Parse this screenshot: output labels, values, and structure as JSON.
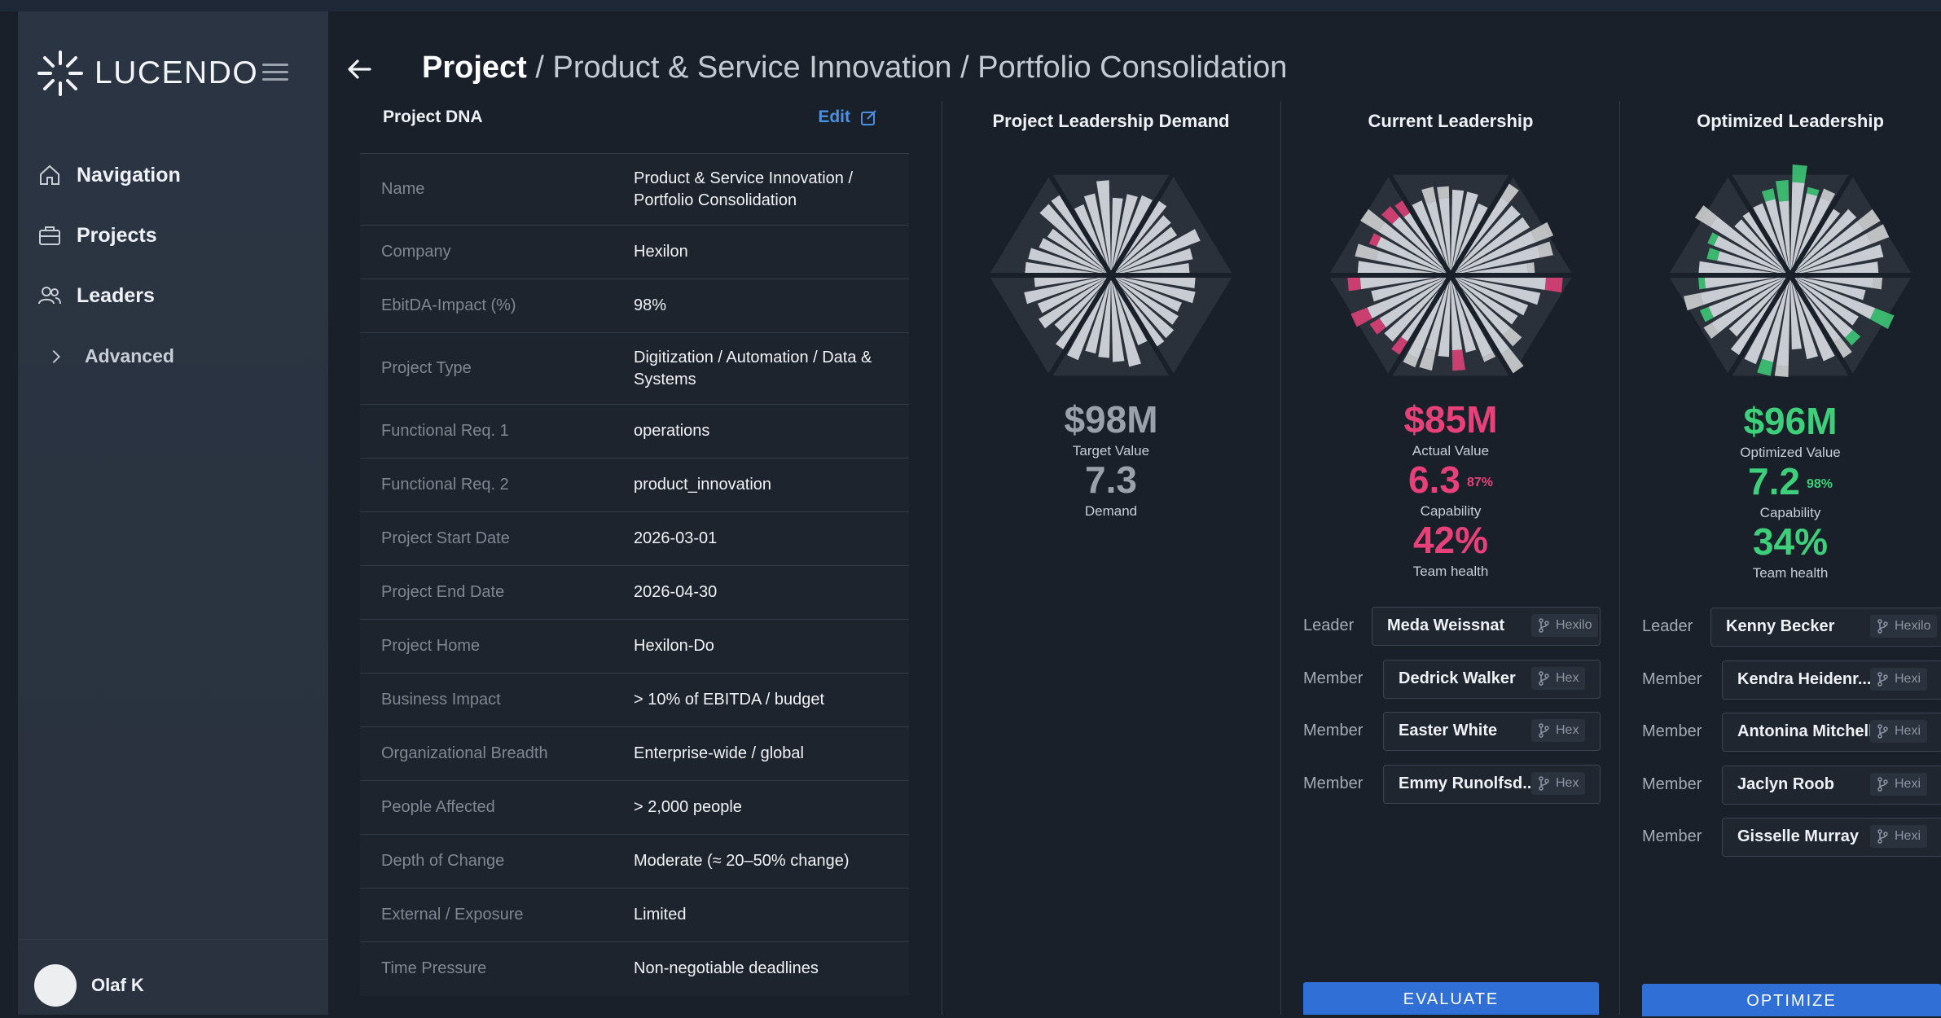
{
  "app": {
    "name": "LUCENDO"
  },
  "sidebar": {
    "items": [
      {
        "label": "Navigation",
        "icon": "home-icon"
      },
      {
        "label": "Projects",
        "icon": "briefcase-icon"
      },
      {
        "label": "Leaders",
        "icon": "users-icon"
      },
      {
        "label": "Advanced",
        "icon": "chevron-right-icon"
      }
    ],
    "user": {
      "name": "Olaf K"
    }
  },
  "header": {
    "breadcrumb_root": "Project",
    "breadcrumb_rest": " / Product & Service Innovation / Portfolio Consolidation"
  },
  "dna": {
    "title": "Project DNA",
    "edit_label": "Edit",
    "rows": [
      {
        "label": "Name",
        "value": "Product & Service Innovation / Portfolio Consolidation"
      },
      {
        "label": "Company",
        "value": "Hexilon"
      },
      {
        "label": "EbitDA-Impact (%)",
        "value": "98%"
      },
      {
        "label": "Project Type",
        "value": "Digitization / Automation / Data & Systems"
      },
      {
        "label": "Functional Req. 1",
        "value": "operations"
      },
      {
        "label": "Functional Req. 2",
        "value": "product_innovation"
      },
      {
        "label": "Project Start Date",
        "value": "2026-03-01"
      },
      {
        "label": "Project End Date",
        "value": "2026-04-30"
      },
      {
        "label": "Project Home",
        "value": "Hexilon-Do"
      },
      {
        "label": "Business Impact",
        "value": "> 10% of EBITDA / budget"
      },
      {
        "label": "Organizational Breadth",
        "value": "Enterprise-wide / global"
      },
      {
        "label": "People Affected",
        "value": "> 2,000 people"
      },
      {
        "label": "Depth of Change",
        "value": "Moderate (≈ 20–50% change)"
      },
      {
        "label": "External / Exposure",
        "value": "Limited"
      },
      {
        "label": "Time Pressure",
        "value": "Non-negotiable deadlines"
      }
    ]
  },
  "panels": {
    "demand": {
      "title": "Project Leadership Demand",
      "money": "$98M",
      "money_label": "Target Value",
      "score": "7.3",
      "score_label": "Demand"
    },
    "current": {
      "title": "Current Leadership",
      "money": "$85M",
      "money_label": "Actual Value",
      "score": "6.3",
      "score_pct": "87%",
      "score_label": "Capability",
      "health": "42%",
      "health_label": "Team health",
      "accent": "#e8417a",
      "members": [
        {
          "role": "Leader",
          "name": "Meda Weissnat",
          "tag": "Hexilo"
        },
        {
          "role": "Member",
          "name": "Dedrick Walker",
          "tag": "Hex"
        },
        {
          "role": "Member",
          "name": "Easter White",
          "tag": "Hex"
        },
        {
          "role": "Member",
          "name": "Emmy Runolfsd...",
          "tag": "Hex"
        }
      ],
      "button": "EVALUATE"
    },
    "optimized": {
      "title": "Optimized Leadership",
      "money": "$96M",
      "money_label": "Optimized Value",
      "score": "7.2",
      "score_pct": "98%",
      "score_label": "Capability",
      "health": "34%",
      "health_label": "Team health",
      "accent": "#3ecf7a",
      "members": [
        {
          "role": "Leader",
          "name": "Kenny Becker",
          "tag": "Hexilo"
        },
        {
          "role": "Member",
          "name": "Kendra Heidenr...",
          "tag": "Hexi"
        },
        {
          "role": "Member",
          "name": "Antonina Mitchell",
          "tag": "Hexi"
        },
        {
          "role": "Member",
          "name": "Jaclyn Roob",
          "tag": "Hexi"
        },
        {
          "role": "Member",
          "name": "Gisselle Murray",
          "tag": "Hexi"
        }
      ],
      "button": "OPTIMIZE"
    }
  },
  "colors": {
    "background": "#1a2029",
    "sidebar": "#2b3442",
    "accent_blue": "#2f6fd6",
    "demand_gray": "#9aa1ab",
    "current_pink": "#e8417a",
    "optimized_green": "#3ecf7a"
  }
}
